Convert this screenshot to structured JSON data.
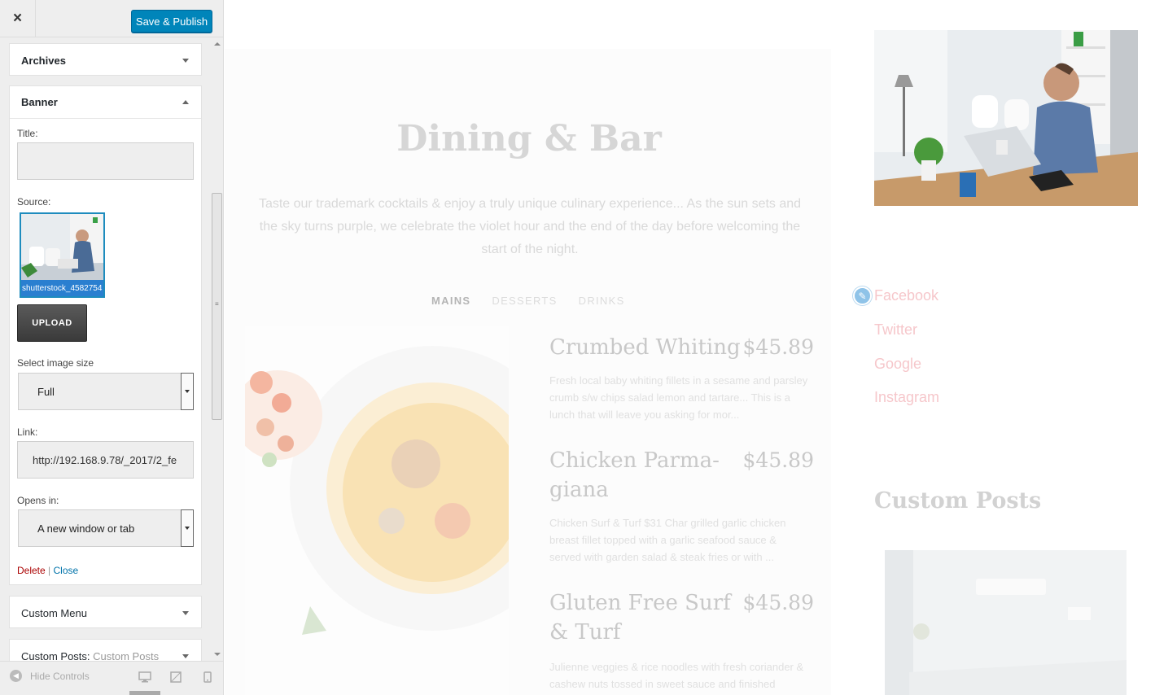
{
  "customizer": {
    "close_icon": "×",
    "publish_label": "Save & Publish",
    "sections": {
      "archives": "Archives",
      "banner": "Banner",
      "custom_menu": "Custom Menu",
      "custom_posts_label": "Custom Posts:",
      "custom_posts_value": "Custom Posts"
    },
    "banner_widget": {
      "title_label": "Title:",
      "title_value": "",
      "source_label": "Source:",
      "image_caption": "shutterstock_4582754",
      "upload_label": "UPLOAD",
      "image_size_label": "Select image size",
      "image_size_value": "Full",
      "link_label": "Link:",
      "link_value": "http://192.168.9.78/_2017/2_fe",
      "opens_in_label": "Opens in:",
      "opens_in_value": "A new window or tab",
      "delete_label": "Delete",
      "separator": "|",
      "close_label": "Close"
    },
    "footer": {
      "hide_controls_label": "Hide Controls",
      "devices": [
        "desktop-icon",
        "tablet-icon",
        "mobile-icon"
      ]
    }
  },
  "preview": {
    "menu": {
      "title": "Dining & Bar",
      "intro": "Taste our trademark cocktails & enjoy a truly unique culinary experience... As the sun sets and the sky turns purple, we celebrate the violet hour and the end of the day before welcoming the start of the night.",
      "tabs": [
        "MAINS",
        "DESSERTS",
        "DRINKS"
      ],
      "dishes": [
        {
          "name": "Crumbed Whiting",
          "price": "$45.89",
          "description": "Fresh local baby whiting fillets in a sesame and parsley crumb s/w chips salad lemon and tartare... This is a lunch that will leave you asking for mor..."
        },
        {
          "name": "Chicken Parma-giana",
          "price": "$45.89",
          "description": "Chicken Surf & Turf $31 Char grilled garlic chicken breast fillet topped with a garlic seafood sauce & served with garden salad & steak fries or with ..."
        },
        {
          "name": "Gluten Free Surf & Turf",
          "price": "$45.89",
          "description": "Julienne veggies & rice noodles with fresh coriander & cashew nuts tossed in sweet sauce and finished"
        }
      ]
    },
    "social": [
      "Facebook",
      "Twitter",
      "Google",
      "Instagram"
    ],
    "custom_posts_title": "Custom Posts",
    "colors": {
      "accent": "#0085ba",
      "social_link": "#f6c7cb",
      "delete": "#aa0000",
      "link": "#0073aa"
    }
  }
}
